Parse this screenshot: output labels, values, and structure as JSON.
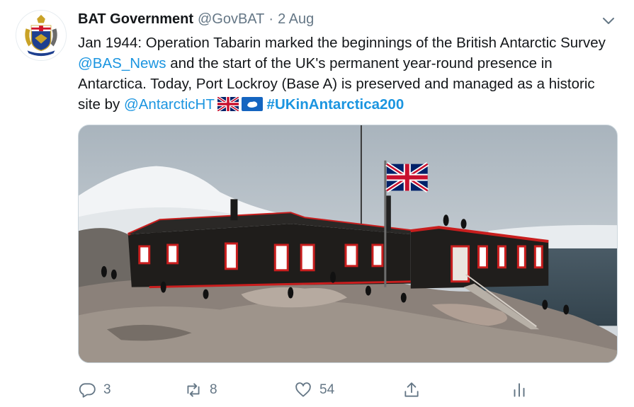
{
  "tweet": {
    "display_name": "BAT Government",
    "handle": "@GovBAT",
    "separator": "·",
    "time": "2 Aug",
    "text_1": "Jan 1944: Operation Tabarin marked the beginnings of the British Antarctic Survey ",
    "mention_1": "@BAS_News",
    "text_2": " and the start of the UK's permanent year-round presence in Antarctica. Today, Port Lockroy (Base A) is preserved and managed as a historic site by ",
    "mention_2": "@AntarcticHT",
    "hashtag": "#UKinAntarctica200"
  },
  "icons": {
    "avatar": "bat-coat-of-arms",
    "caret": "chevron-down-icon",
    "flags": [
      "uk-flag-icon",
      "antarctica-flag-icon"
    ],
    "reply": "reply-icon",
    "retweet": "retweet-icon",
    "like": "heart-icon",
    "share": "share-icon",
    "analytics": "analytics-icon"
  },
  "actions": {
    "reply_count": "3",
    "retweet_count": "8",
    "like_count": "54"
  },
  "colors": {
    "link": "#1b95e0",
    "muted": "#657786",
    "text": "#14171a"
  }
}
